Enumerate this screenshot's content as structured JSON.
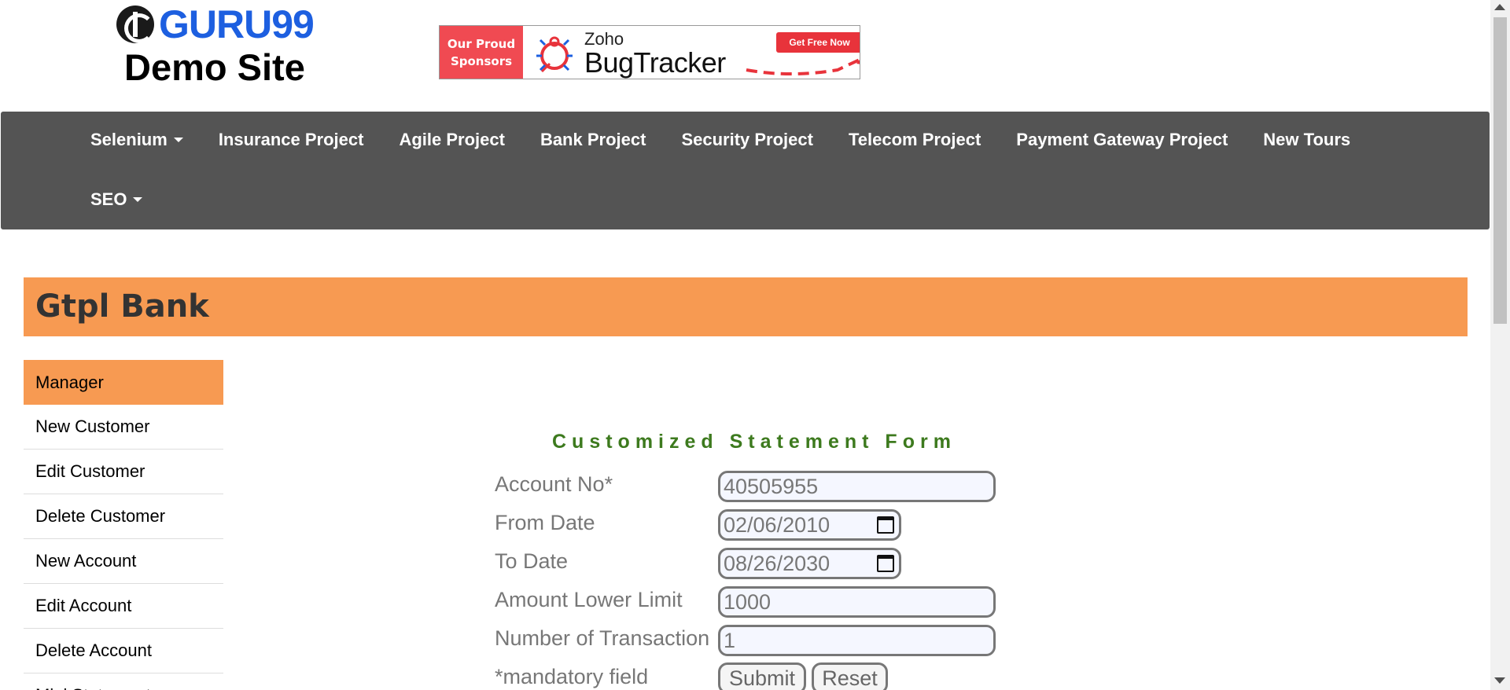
{
  "header": {
    "logo_text": "GURU99",
    "site_title": "Demo Site"
  },
  "ad": {
    "sponsor_line1": "Our Proud",
    "sponsor_line2": "Sponsors",
    "brand": "Zoho",
    "product": "BugTracker",
    "cta": "Get Free Now"
  },
  "nav": {
    "row1": [
      "Selenium",
      "Insurance Project",
      "Agile Project",
      "Bank Project",
      "Security Project",
      "Telecom Project",
      "Payment Gateway Project",
      "New Tours"
    ],
    "row2": [
      "SEO"
    ]
  },
  "bank": {
    "title": "Gtpl Bank"
  },
  "sidebar": {
    "items": [
      "Manager",
      "New Customer",
      "Edit Customer",
      "Delete Customer",
      "New Account",
      "Edit Account",
      "Delete Account",
      "Mini Statement"
    ]
  },
  "form": {
    "title": "Customized Statement Form",
    "account_no_label": "Account No*",
    "account_no_value": "40505955",
    "from_date_label": "From Date",
    "from_date_value": "02/06/2010",
    "to_date_label": "To Date",
    "to_date_value": "08/26/2030",
    "amount_lower_label": "Amount Lower Limit",
    "amount_lower_value": "1000",
    "num_transaction_label": "Number of Transaction",
    "num_transaction_value": "1",
    "mandatory_note": "*mandatory field",
    "submit_label": "Submit",
    "reset_label": "Reset"
  },
  "colors": {
    "accent_orange": "#f79a52",
    "nav_bg": "#545454",
    "logo_blue": "#1d5fe0",
    "form_title_green": "#3d7a1e"
  }
}
